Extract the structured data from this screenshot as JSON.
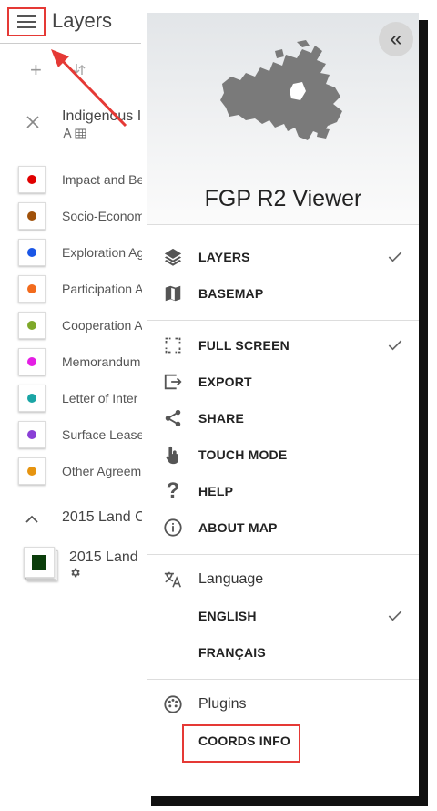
{
  "panel": {
    "title": "Layers",
    "layer_group_title": "Indigenous I",
    "legend_items": [
      {
        "label": "Impact and Be",
        "color": "#e00000"
      },
      {
        "label": "Socio-Econom",
        "color": "#a0510a"
      },
      {
        "label": "Exploration Ag",
        "color": "#1a56e6"
      },
      {
        "label": "Participation A",
        "color": "#f26b1d"
      },
      {
        "label": "Cooperation A",
        "color": "#7ea829"
      },
      {
        "label": "Memorandum",
        "color": "#e41ee4"
      },
      {
        "label": "Letter of Inter",
        "color": "#1aa5a5"
      },
      {
        "label": "Surface Lease",
        "color": "#8a3fd6"
      },
      {
        "label": "Other Agreem",
        "color": "#e69410"
      }
    ],
    "land_group_title": "2015 Land C",
    "land_layer_title": "2015 Land",
    "land_swatch_color": "#0b3d0b"
  },
  "drawer": {
    "title": "FGP R2 Viewer",
    "sections": {
      "layers_label": "LAYERS",
      "basemap_label": "BASEMAP",
      "fullscreen_label": "FULL SCREEN",
      "export_label": "EXPORT",
      "share_label": "SHARE",
      "touch_label": "TOUCH MODE",
      "help_label": "HELP",
      "about_label": "ABOUT MAP",
      "language_label": "Language",
      "english_label": "ENGLISH",
      "french_label": "FRANÇAIS",
      "plugins_label": "Plugins",
      "coords_label": "COORDS INFO"
    }
  },
  "colors": {
    "highlight": "#e53935",
    "map_shape": "#7a7a7a"
  }
}
